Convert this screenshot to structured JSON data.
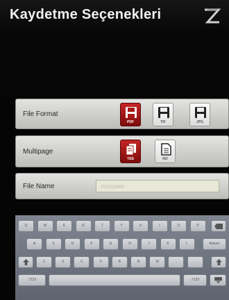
{
  "header": {
    "title": "Kaydetme Seçenekleri",
    "logo_icon": "z-logo-icon"
  },
  "file_format": {
    "label": "File Format",
    "options": [
      {
        "label": "PDF",
        "icon": "save-disk-icon",
        "selected": true
      },
      {
        "label": "TIF",
        "icon": "save-disk-icon",
        "selected": false
      },
      {
        "label": "JPG",
        "icon": "save-disk-icon",
        "selected": false
      }
    ]
  },
  "multipage": {
    "label": "Multipage",
    "options": [
      {
        "label": "YES",
        "icon": "multi-page-icon",
        "selected": true
      },
      {
        "label": "NO",
        "icon": "single-page-icon",
        "selected": false
      }
    ]
  },
  "file_name": {
    "label": "File Name",
    "value": "",
    "placeholder": "mycopies"
  },
  "keyboard": {
    "row1": [
      "Q",
      "W",
      "E",
      "R",
      "T",
      "Y",
      "U",
      "I",
      "O",
      "P"
    ],
    "backspace_icon": "backspace-icon",
    "row2": [
      "A",
      "S",
      "D",
      "F",
      "G",
      "H",
      "J",
      "K",
      "L"
    ],
    "return_label": "Return",
    "shift_icon": "shift-icon",
    "row3": [
      "Z",
      "X",
      "C",
      "V",
      "B",
      "N",
      "M",
      ",",
      "."
    ],
    "symbols_label": ".?123",
    "symbols_label_right": ".?123",
    "hide_keyboard_icon": "keyboard-hide-icon"
  },
  "colors": {
    "accent": "#a81818",
    "panel": "#d4d4d0",
    "background": "#050505"
  }
}
